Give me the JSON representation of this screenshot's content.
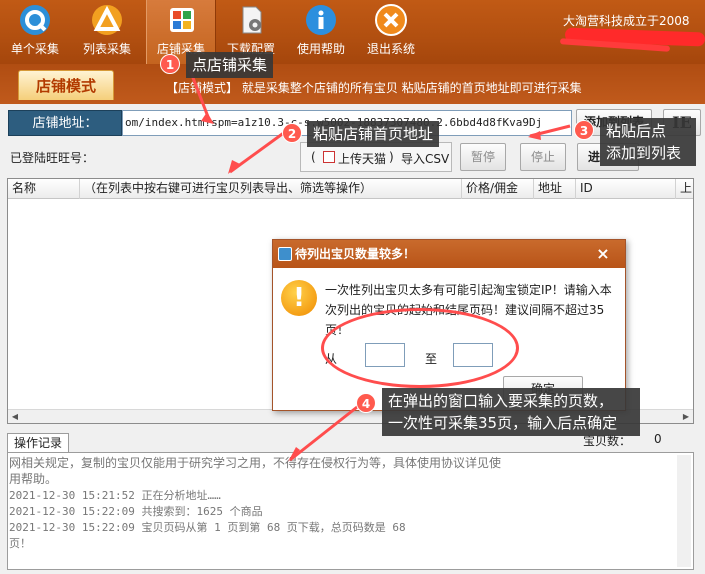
{
  "toolbar": {
    "buttons": [
      {
        "label": "单个采集",
        "icon": "q-icon"
      },
      {
        "label": "列表采集",
        "icon": "triangle-logo-icon"
      },
      {
        "label": "店铺采集",
        "icon": "shop-grid-icon"
      },
      {
        "label": "下载配置",
        "icon": "settings-document-icon"
      },
      {
        "label": "使用帮助",
        "icon": "info-icon"
      },
      {
        "label": "退出系统",
        "icon": "close-icon"
      }
    ],
    "active_index": 2,
    "brand_text": "大淘营科技成立于2008"
  },
  "mode": {
    "tab_label": "店铺模式",
    "description": "【店铺模式】 就是采集整个店铺的所有宝贝 粘贴店铺的首页地址即可进行采集"
  },
  "address": {
    "label": "店铺地址：",
    "value": "om/index.htm?spm=a1z10.3-c-s.w5002-18837307480.2.6bbd4d8fKva9Dj",
    "add_button": "添加到列表",
    "ie_button": "IE"
  },
  "controls": {
    "wangwang_label": "已登陆旺旺号：",
    "paren_open": "(",
    "upload_tmall": "上传天猫",
    "paren_close": ")",
    "import_csv": "导入CSV",
    "pause": "暂停",
    "stop": "停止",
    "go": "进"
  },
  "list": {
    "columns": [
      "名称",
      "（在列表中按右键可进行宝贝列表导出、筛选等操作）",
      "价格/佣金",
      "地址",
      "ID",
      "上"
    ]
  },
  "log": {
    "tab_label": "操作记录",
    "sold_label": "宝贝数：",
    "sold_value": "0",
    "notice": "网相关规定，复制的宝贝仅能用于研究学习之用，不得存在侵权行为等，具体使用协议详见使用帮助。",
    "entries": [
      "2021-12-30  15:21:52   正在分析地址……",
      "2021-12-30  15:22:09   共搜索到：1625 个商品",
      "2021-12-30  15:22:09   宝贝页码从第 1 页到第  68  页下载，总页码数是 68",
      "页！"
    ]
  },
  "dialog": {
    "title": "待列出宝贝数量较多！",
    "close": "×",
    "message": "一次性列出宝贝太多有可能引起淘宝锁定IP！请输入本次列出的宝贝的起始和结尾页码！建议间隔不超过35页！",
    "from_label": "从",
    "to_label": "至",
    "ok": "确定",
    "warn_glyph": "!"
  },
  "annotations": {
    "accent": "#ff4d4d",
    "steps": [
      {
        "num": "1",
        "text": "点店铺采集"
      },
      {
        "num": "2",
        "text": "粘贴店铺首页地址"
      },
      {
        "num": "3",
        "text": "粘贴后点\n添加到列表"
      },
      {
        "num": "4",
        "text": "在弹出的窗口输入要采集的页数，\n一次性可采集35页，输入后点确定"
      }
    ]
  }
}
